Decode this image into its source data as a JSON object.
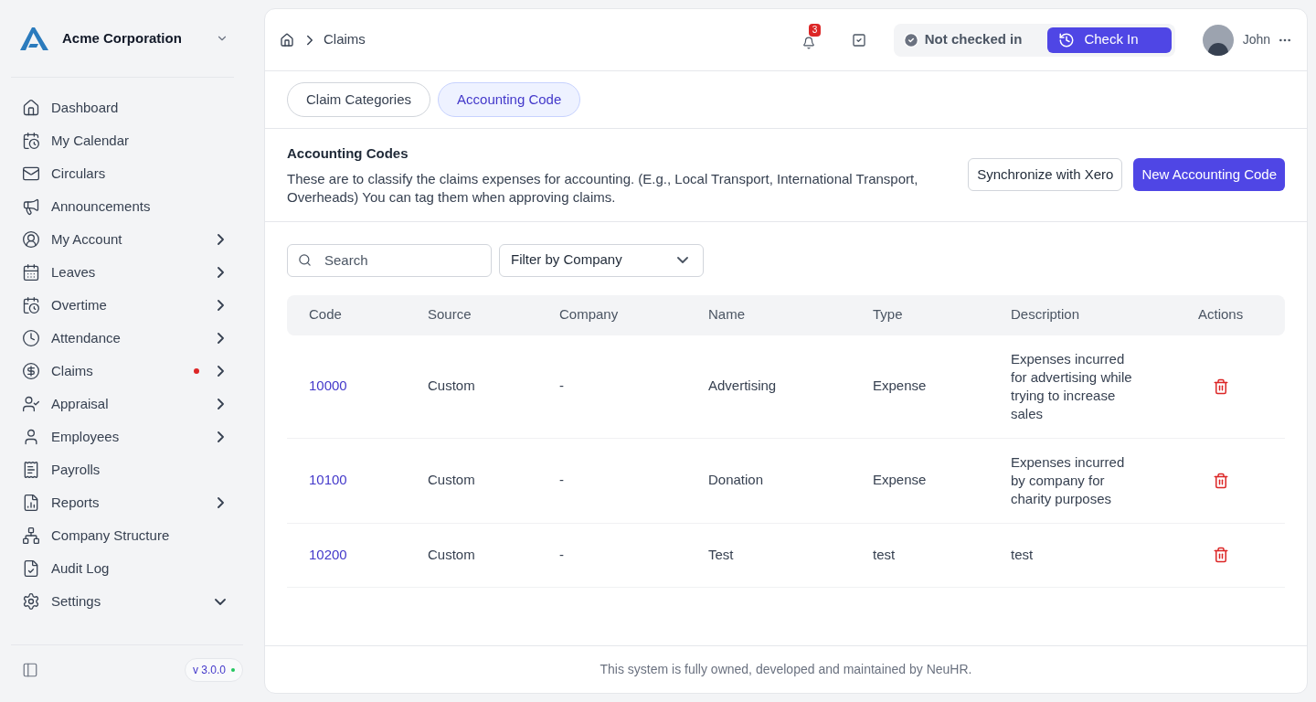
{
  "sidebar": {
    "company": "Acme Corporation",
    "items": [
      {
        "label": "Dashboard",
        "alert": false
      },
      {
        "label": "My Calendar",
        "alert": false
      },
      {
        "label": "Circulars",
        "alert": false
      },
      {
        "label": "Announcements",
        "alert": false
      },
      {
        "label": "My Account",
        "expanded": false,
        "alert": false
      },
      {
        "label": "Leaves",
        "expanded": false,
        "alert": false
      },
      {
        "label": "Overtime",
        "expanded": false,
        "alert": false
      },
      {
        "label": "Attendance",
        "expanded": false,
        "alert": false
      },
      {
        "label": "Claims",
        "expanded": false,
        "alert": true
      },
      {
        "label": "Appraisal",
        "expanded": false,
        "alert": false
      },
      {
        "label": "Employees",
        "expanded": false,
        "alert": false
      },
      {
        "label": "Payrolls",
        "alert": false
      },
      {
        "label": "Reports",
        "expanded": false,
        "alert": false
      },
      {
        "label": "Company Structure",
        "alert": false
      },
      {
        "label": "Audit Log",
        "alert": false
      },
      {
        "label": "Settings",
        "expanded": true,
        "alert": false
      }
    ],
    "version": "v 3.0.0"
  },
  "header": {
    "breadcrumb": "Claims",
    "notifications": "3",
    "status": "Not checked in",
    "check_in": "Check In",
    "user": "John"
  },
  "tabs": [
    {
      "label": "Claim Categories",
      "selected": false
    },
    {
      "label": "Accounting Code",
      "selected": true
    }
  ],
  "section": {
    "title": "Accounting Codes",
    "description": "These are to classify the claims expenses for accounting. (E.g., Local Transport, International Transport, Overheads) You can tag them when approving claims.",
    "buttons": [
      {
        "label": "Synchronize with Xero",
        "kind": "secondary"
      },
      {
        "label": "New Accounting Code",
        "kind": "primary"
      }
    ]
  },
  "filters": {
    "search": {
      "placeholder": "Search"
    },
    "company": "Filter by Company"
  },
  "table": {
    "columns": [
      "Code",
      "Source",
      "Company",
      "Name",
      "Type",
      "Description",
      "Actions"
    ],
    "rows": [
      {
        "code": "10000",
        "source": "Custom",
        "company": "-",
        "name": "Advertising",
        "type": "Expense",
        "description": "Expenses incurred for advertising while trying to increase sales"
      },
      {
        "code": "10100",
        "source": "Custom",
        "company": "-",
        "name": "Donation",
        "type": "Expense",
        "description": "Expenses incurred by company for charity purposes"
      },
      {
        "code": "10200",
        "source": "Custom",
        "company": "-",
        "name": "Test",
        "type": "test",
        "description": "test"
      }
    ]
  },
  "footer": "This system is fully owned, developed and maintained by NeuHR."
}
